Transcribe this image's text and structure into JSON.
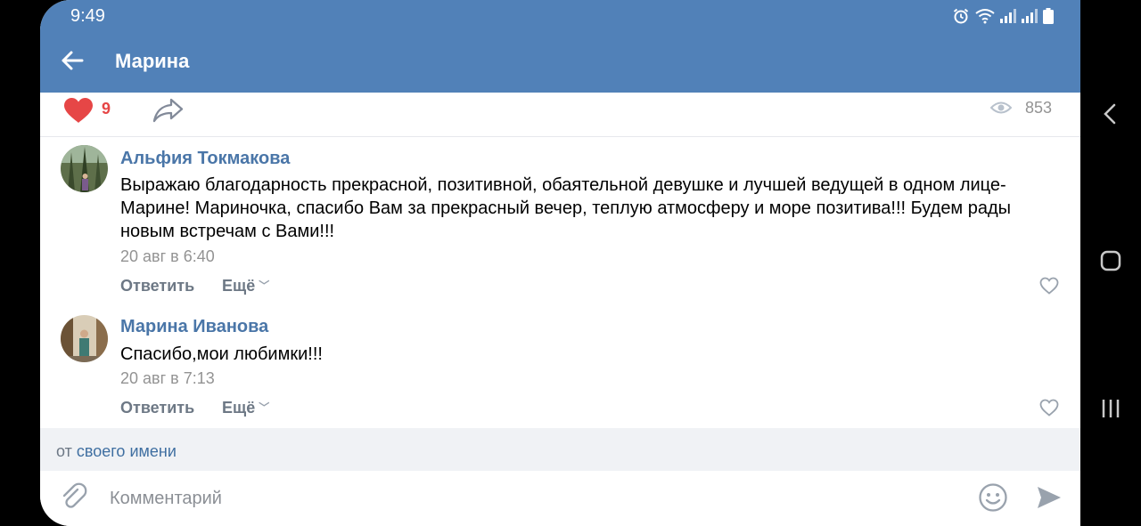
{
  "status_bar": {
    "time": "9:49",
    "icons": [
      "alarm-icon",
      "wifi-icon",
      "signal-icon",
      "signal-icon",
      "battery-icon"
    ]
  },
  "header": {
    "title": "Марина",
    "back_icon": "arrow-left-icon"
  },
  "post_actions": {
    "likes": "9",
    "views": "853",
    "like_color": "#e64646"
  },
  "comments": [
    {
      "author": "Альфия Токмакова",
      "text": "Выражаю благодарность прекрасной, позитивной, обаятельной девушке и лучшей ведущей в одном лице- Марине! Мариночка, спасибо Вам за прекрасный вечер, теплую атмосферу и море позитива!!! Будем рады новым встречам с Вами!!!",
      "date": "20 авг в 6:40",
      "reply_label": "Ответить",
      "more_label": "Ещё"
    },
    {
      "author": "Марина Иванова",
      "text": "Спасибо,мои любимки!!!",
      "date": "20 авг в 7:13",
      "reply_label": "Ответить",
      "more_label": "Ещё"
    }
  ],
  "from_bar": {
    "prefix": "от",
    "link": "своего имени"
  },
  "input": {
    "placeholder": "Комментарий",
    "value": ""
  },
  "colors": {
    "header_bg": "#5181b8",
    "link": "#4a76a8",
    "secondary_text": "#939393"
  }
}
